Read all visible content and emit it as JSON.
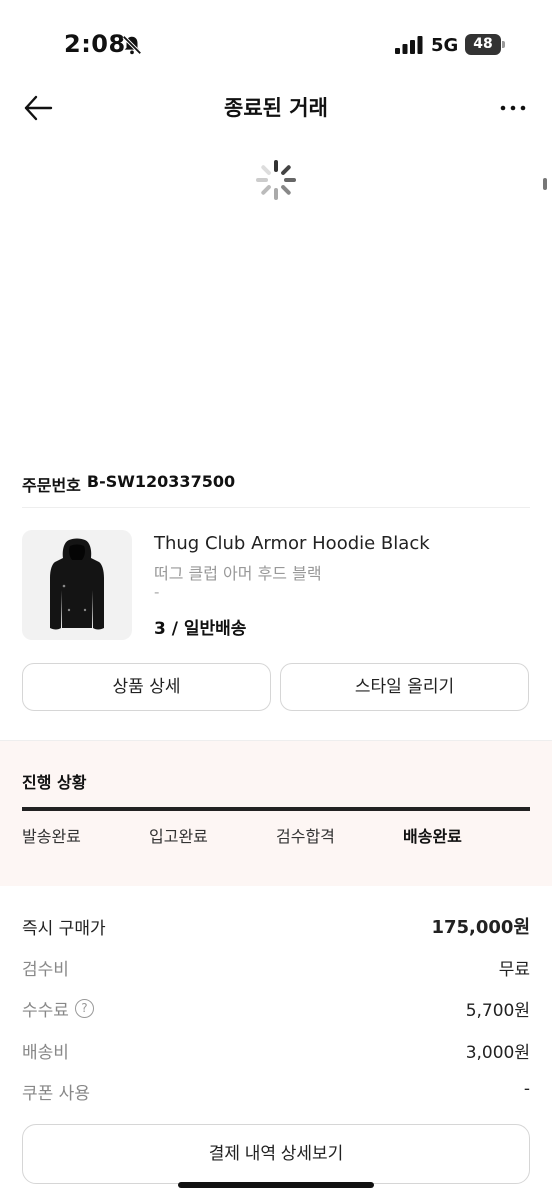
{
  "status_bar": {
    "time": "2:08",
    "network": "5G",
    "battery": "48"
  },
  "nav": {
    "title": "종료된 거래"
  },
  "order": {
    "label": "주문번호",
    "number": "B-SW120337500"
  },
  "product": {
    "name_en": "Thug Club Armor Hoodie Black",
    "name_ko": "떠그 클럽 아머 후드 블랙",
    "dash": "-",
    "option": "3 / 일반배송"
  },
  "buttons": {
    "product_detail": "상품 상세",
    "style_upload": "스타일 올리기",
    "payment_detail": "결제 내역 상세보기"
  },
  "progress": {
    "title": "진행 상황",
    "fill_fraction": 1.0,
    "steps": [
      "발송완료",
      "입고완료",
      "검수합격",
      "배송완료"
    ],
    "active_index": 3
  },
  "prices": {
    "buy_now": {
      "label": "즉시 구매가",
      "value": "175,000원"
    },
    "inspection": {
      "label": "검수비",
      "value": "무료"
    },
    "fee": {
      "label": "수수료",
      "help": "?",
      "value": "5,700원"
    },
    "shipping": {
      "label": "배송비",
      "value": "3,000원"
    },
    "coupon": {
      "label": "쿠폰 사용",
      "value": "-"
    }
  },
  "colors": {
    "progress_bg": "#fdf6f4",
    "progress_fill": "#222222"
  },
  "icons": {
    "back": "arrow-left-icon",
    "more": "more-horizontal-icon",
    "spinner": "loading-spinner-icon",
    "bell": "bell-slash-icon",
    "help": "question-circle-icon"
  }
}
